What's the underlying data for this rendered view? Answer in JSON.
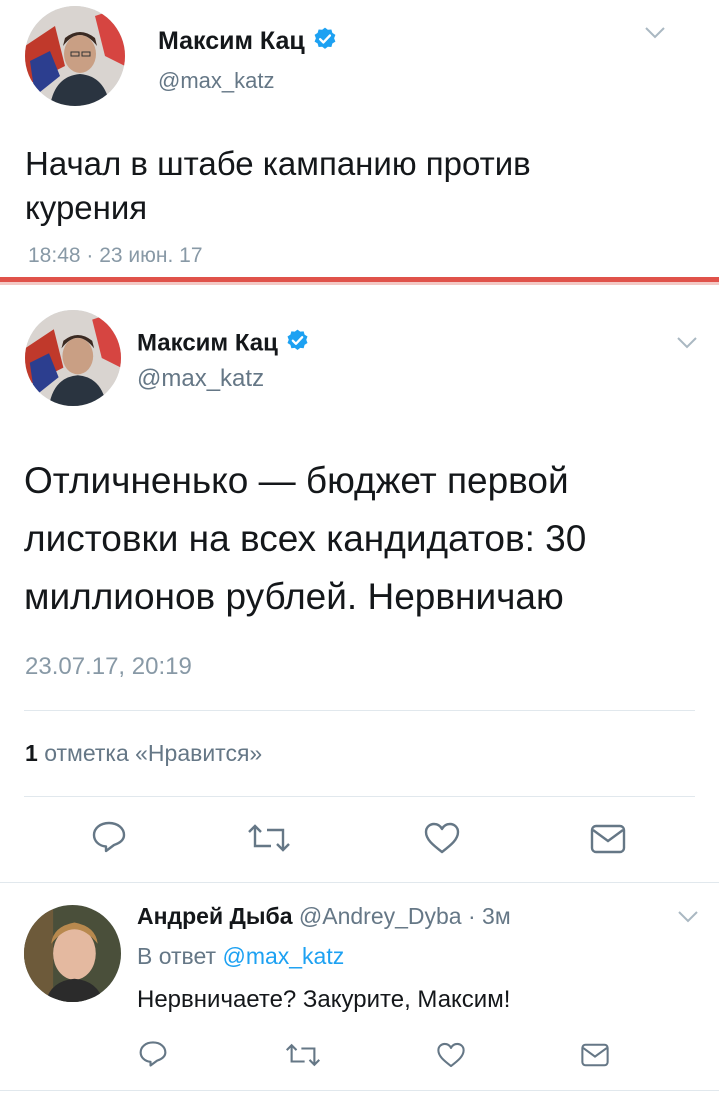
{
  "colors": {
    "accent": "#1da1f2",
    "separator": "#e0524a",
    "muted": "#657786"
  },
  "tweet1": {
    "author_name": "Максим Кац",
    "author_handle": "@max_katz",
    "text_line1": "Начал в штабе кампанию против",
    "text_line2": "курения",
    "timestamp": "18:48 · 23 июн. 17"
  },
  "tweet2": {
    "author_name": "Максим Кац",
    "author_handle": "@max_katz",
    "text_line1": "Отличненько — бюджет первой",
    "text_line2": "листовки на всех кандидатов: 30",
    "text_line3": "миллионов рублей. Нервничаю",
    "timestamp": "23.07.17, 20:19",
    "likes_count": "1",
    "likes_label": "отметка «Нравится»",
    "actions": [
      "reply-icon",
      "retweet-icon",
      "like-icon",
      "message-icon"
    ]
  },
  "reply": {
    "author_name": "Андрей Дыба",
    "author_handle": "@Andrey_Dyba",
    "time": "· 3м",
    "in_reply_label": "В ответ",
    "in_reply_handle": "@max_katz",
    "text": "Нервничаете? Закурите, Максим!",
    "actions": [
      "reply-icon",
      "retweet-icon",
      "like-icon",
      "message-icon"
    ]
  }
}
